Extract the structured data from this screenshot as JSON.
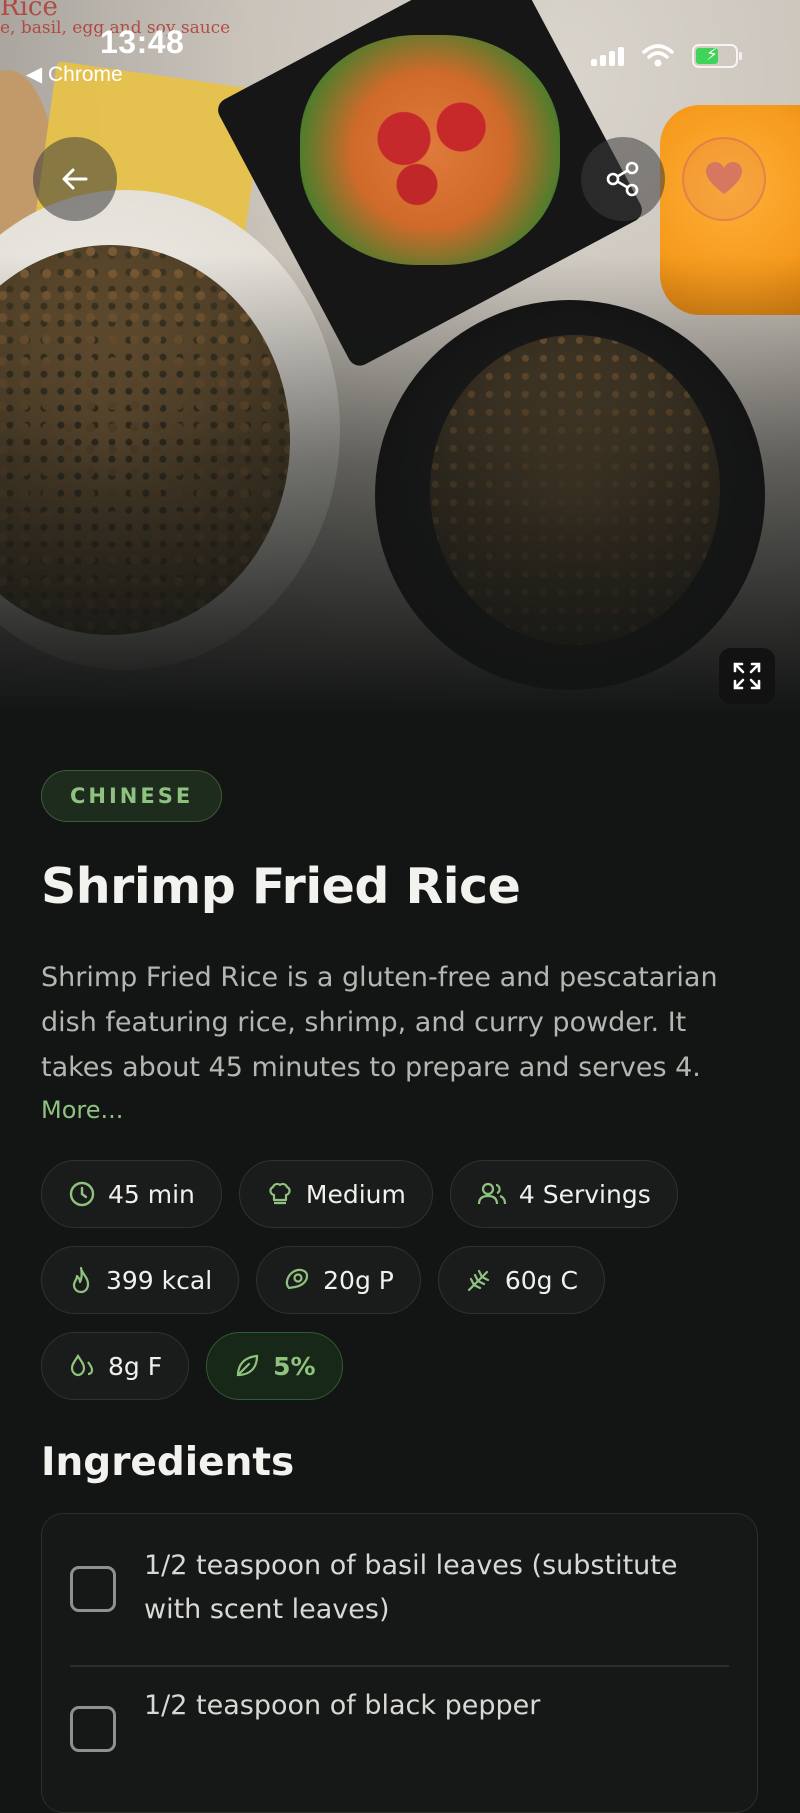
{
  "status_bar": {
    "time": "13:48",
    "back_app": "◀ Chrome"
  },
  "hero": {
    "photo_overlay_text_1": "Rice",
    "photo_overlay_text_2": "e, basil, egg and soy sauce"
  },
  "actions": {
    "back_icon": "arrow-left-icon",
    "share_icon": "share-icon",
    "favorite_icon": "heart-icon",
    "expand_icon": "expand-icon"
  },
  "recipe": {
    "cuisine": "CHINESE",
    "title": "Shrimp Fried Rice",
    "description": "Shrimp Fried Rice is a gluten-free and pescatarian dish featuring rice, shrimp, and curry powder. It takes about 45 minutes to prepare and serves 4.",
    "more_label": "More..."
  },
  "chips": {
    "time": "45 min",
    "difficulty": "Medium",
    "servings": "4 Servings",
    "calories": "399 kcal",
    "protein": "20g P",
    "carbs": "60g C",
    "fat": "8g F",
    "health_score": "5%"
  },
  "ingredients": {
    "title": "Ingredients",
    "items": [
      "1/2 teaspoon of basil leaves (substitute with scent leaves)",
      "1/2 teaspoon of black pepper"
    ]
  },
  "colors": {
    "background": "#131514",
    "accent_green": "#8fc27f",
    "favorite": "#d6785f"
  }
}
